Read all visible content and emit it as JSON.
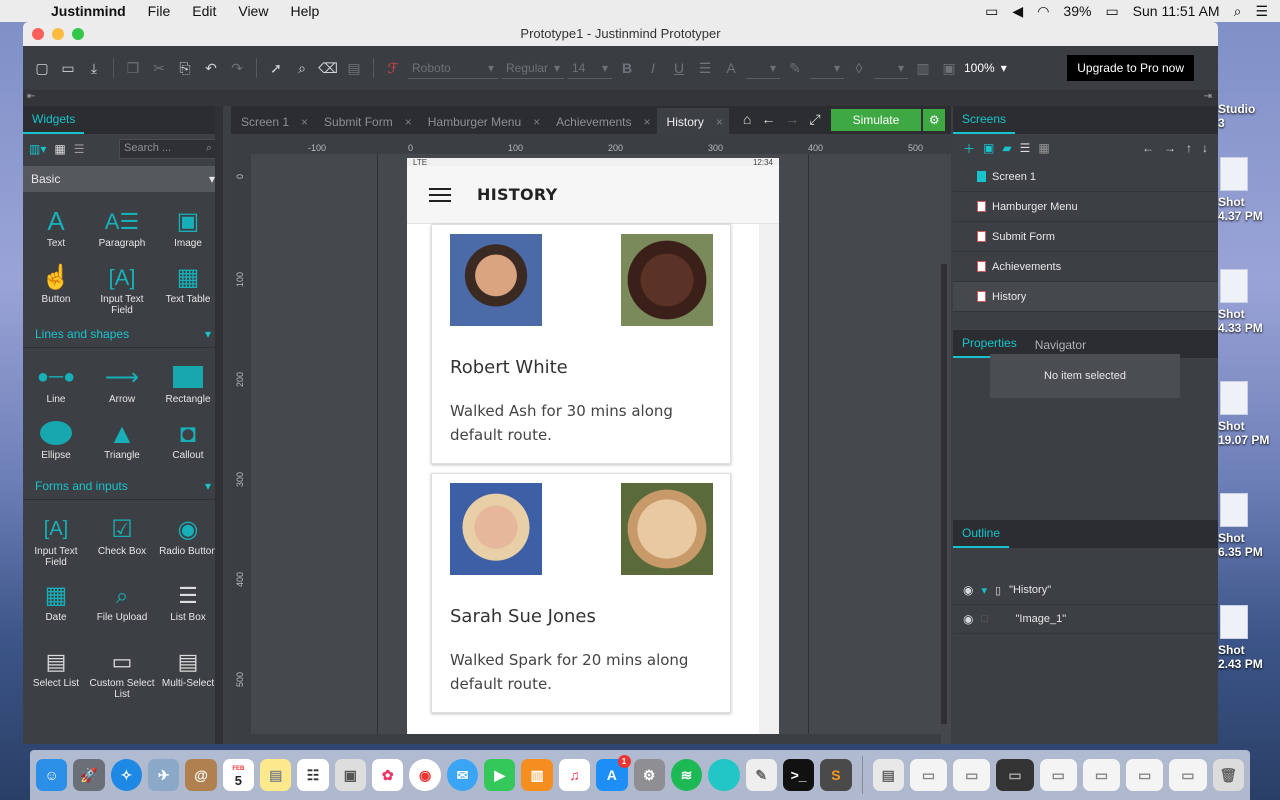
{
  "menubar": {
    "app_name": "Justinmind",
    "items": [
      "File",
      "Edit",
      "View",
      "Help"
    ],
    "battery": "39%",
    "clock": "Sun 11:51 AM"
  },
  "window": {
    "title": "Prototype1 - Justinmind Prototyper"
  },
  "toolbar": {
    "font_family": "Roboto",
    "font_weight": "Regular",
    "font_size": "14",
    "zoom": "100%",
    "upgrade_label": "Upgrade to Pro now"
  },
  "widgets_panel": {
    "tab": "Widgets",
    "search_placeholder": "Search ...",
    "category": "Basic",
    "basic_items": [
      "Text",
      "Paragraph",
      "Image",
      "Button",
      "Input Text Field",
      "Text Table"
    ],
    "lines_section": "Lines and shapes",
    "lines_items": [
      "Line",
      "Arrow",
      "Rectangle",
      "Ellipse",
      "Triangle",
      "Callout"
    ],
    "forms_section": "Forms and inputs",
    "forms_items": [
      "Input Text Field",
      "Check Box",
      "Radio Button",
      "Date",
      "File Upload",
      "List Box",
      "Select List",
      "Custom Select List",
      "Multi-Select"
    ]
  },
  "tabs": [
    {
      "label": "Screen 1"
    },
    {
      "label": "Submit Form"
    },
    {
      "label": "Hamburger Menu"
    },
    {
      "label": "Achievements"
    },
    {
      "label": "History"
    }
  ],
  "simulate_label": "Simulate",
  "ruler": {
    "h": [
      "-100",
      "0",
      "100",
      "200",
      "300",
      "400",
      "500"
    ],
    "v": [
      "0",
      "100",
      "200",
      "300",
      "400",
      "500"
    ]
  },
  "device": {
    "carrier": "LTE",
    "time": "12:34",
    "title": "HISTORY",
    "cards": [
      {
        "name": "Robert White",
        "desc": "Walked Ash for 30 mins along default route."
      },
      {
        "name": "Sarah Sue Jones",
        "desc": "Walked Spark for 20 mins along default route."
      }
    ]
  },
  "screens_panel": {
    "tab": "Screens",
    "items": [
      "Screen 1",
      "Hamburger Menu",
      "Submit Form",
      "Achievements",
      "History"
    ]
  },
  "properties_panel": {
    "tab": "Properties",
    "tab2": "Navigator",
    "empty": "No item selected"
  },
  "outline_panel": {
    "tab": "Outline",
    "rows": [
      "\"History\"",
      "\"Image_1\""
    ]
  },
  "desktop_icons": [
    {
      "label": "Studio",
      "sub": "3"
    },
    {
      "label": "Shot",
      "sub": "4.37 PM"
    },
    {
      "label": "Shot",
      "sub": "4.33 PM"
    },
    {
      "label": "Shot",
      "sub": "19.07 PM"
    },
    {
      "label": "Shot",
      "sub": "6.35 PM"
    },
    {
      "label": "Shot",
      "sub": "2.43 PM"
    }
  ],
  "dock": {
    "calendar_month": "FEB",
    "calendar_day": "5",
    "appstore_badge": "1"
  },
  "colors": {
    "accent": "#17c4cd",
    "simulate": "#3ea943",
    "panel": "#3c3f43"
  }
}
